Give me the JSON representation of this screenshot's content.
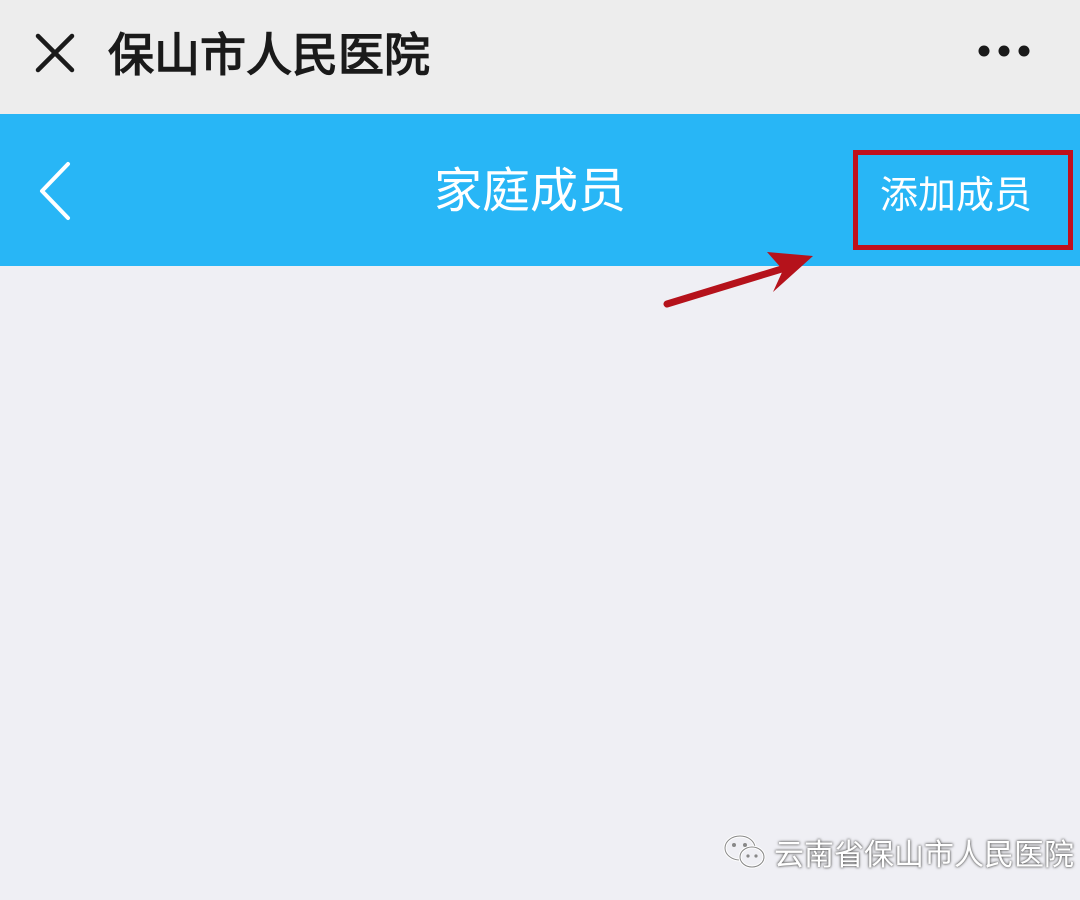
{
  "window": {
    "title": "保山市人民医院",
    "close_icon": "close-icon",
    "more_icon": "more-dots-icon"
  },
  "navbar": {
    "title": "家庭成员",
    "back_icon": "chevron-left-icon",
    "action_label": "添加成员",
    "background": "#28b6f6"
  },
  "annotation": {
    "highlight_color": "#c0101c"
  },
  "watermark": {
    "text": "云南省保山市人民医院",
    "icon": "wechat-logo-icon"
  }
}
